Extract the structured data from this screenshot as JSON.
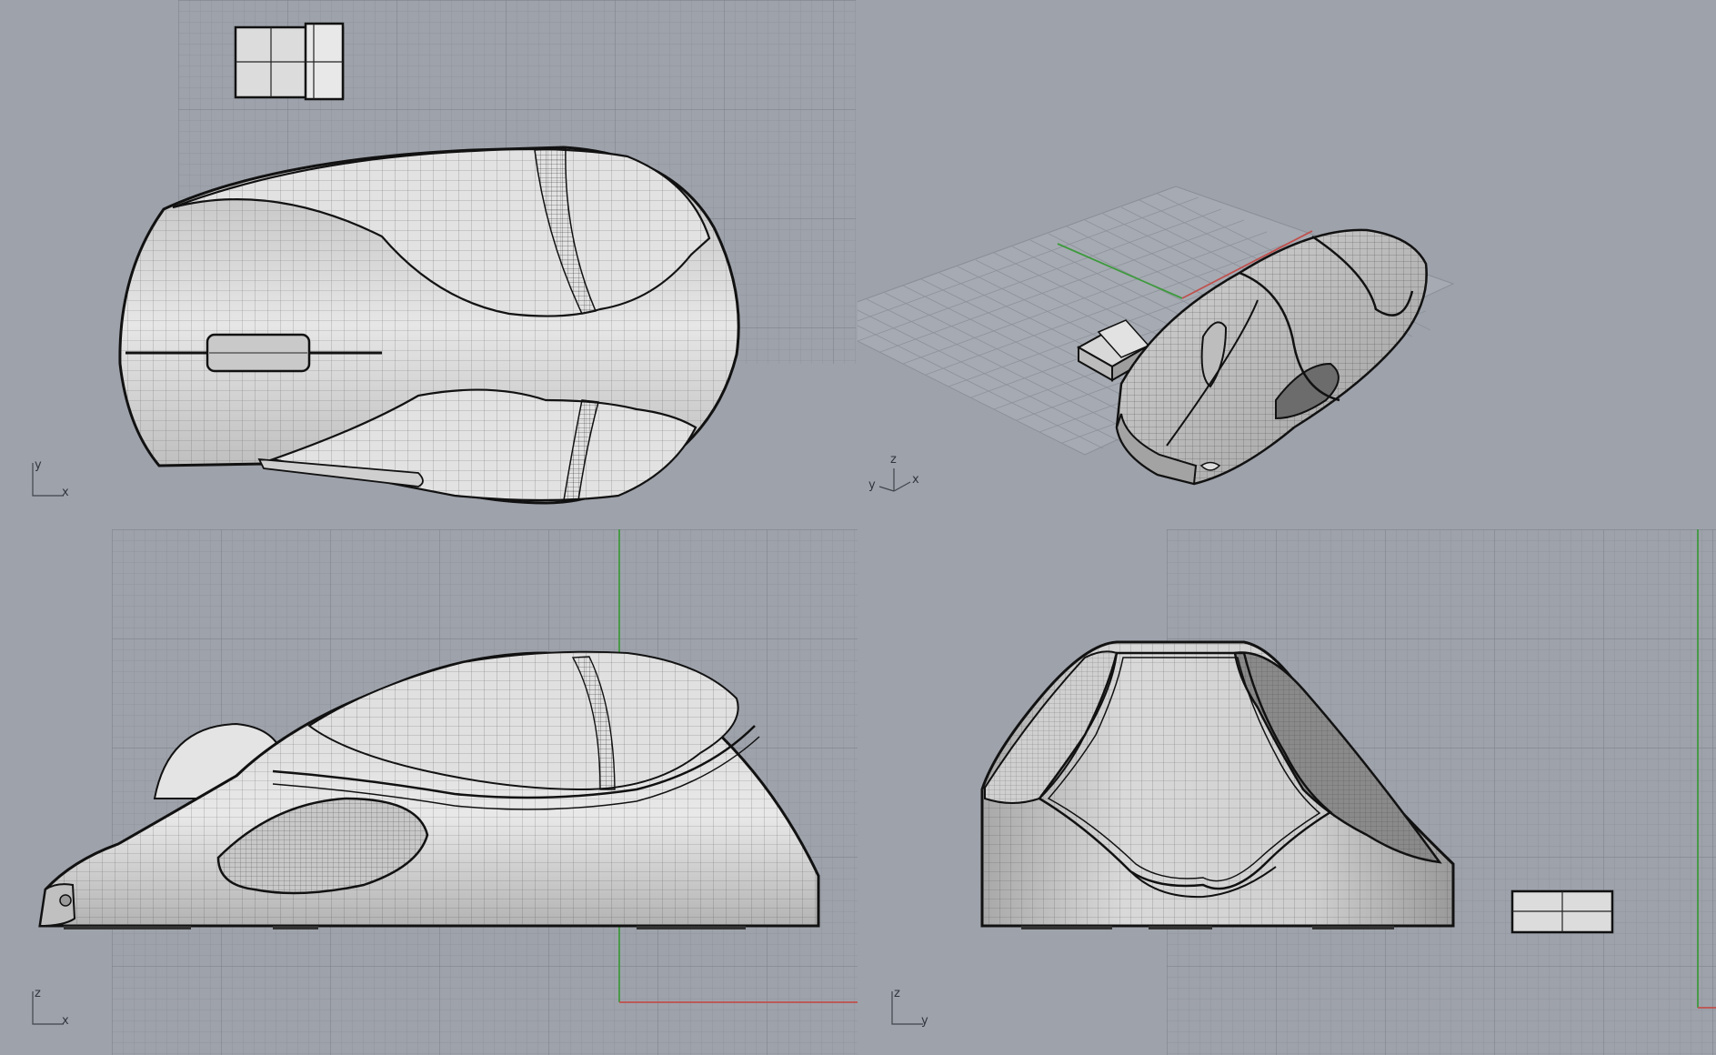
{
  "app": {
    "background": "#9ea2ab",
    "grid_minor_color": "#8f949c",
    "grid_major_color": "#7d828a",
    "x_axis_color": "#c0504d",
    "y_axis_color": "#3e9a3e"
  },
  "viewports": [
    {
      "id": "top",
      "axes": {
        "first": "y",
        "second": "x"
      }
    },
    {
      "id": "perspective",
      "axes": {
        "first": "z",
        "second": "x",
        "third": "y"
      }
    },
    {
      "id": "front",
      "axes": {
        "first": "z",
        "second": "x"
      }
    },
    {
      "id": "right",
      "axes": {
        "first": "z",
        "second": "y"
      }
    }
  ],
  "model": {
    "name": "mouse",
    "parts": [
      "mouse-body",
      "scroll-wheel",
      "usb-receiver"
    ]
  }
}
